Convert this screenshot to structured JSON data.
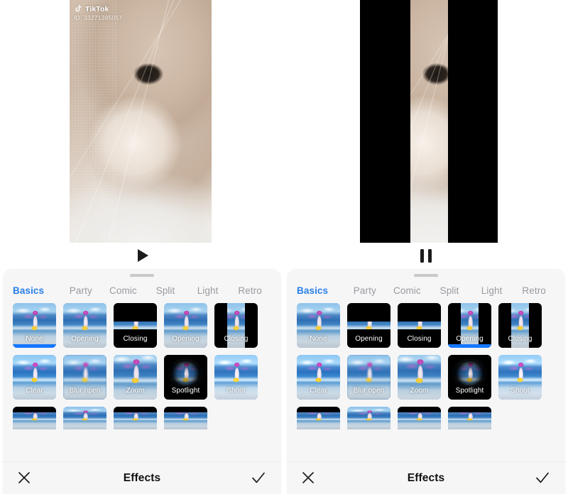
{
  "app": {
    "sheet_title": "Effects",
    "accent_color": "#1677ff",
    "tab_active_color": "#2a7fe8",
    "tab_inactive_color": "#9a9a9f"
  },
  "watermark": {
    "brand": "TikTok",
    "id": "ID: 33271385057",
    "icon": "tiktok-note-icon"
  },
  "panels": [
    {
      "key": "left",
      "transport": {
        "icon": "play-icon",
        "label": "Play",
        "state": "paused"
      },
      "preview": {
        "mode": "full",
        "description": "cat-profile-video-frame"
      },
      "tabs": [
        {
          "label": "Basics",
          "active": true
        },
        {
          "label": "Party",
          "active": false
        },
        {
          "label": "Comic",
          "active": false
        },
        {
          "label": "Split",
          "active": false
        },
        {
          "label": "Light",
          "active": false
        },
        {
          "label": "Retro",
          "active": false
        }
      ],
      "rows": [
        [
          {
            "label": "None",
            "style": "plain",
            "selected": true
          },
          {
            "label": "Opening",
            "style": "plain",
            "selected": false
          },
          {
            "label": "Closing",
            "style": "letterbox-h",
            "selected": false
          },
          {
            "label": "Opening",
            "style": "plain",
            "selected": false
          },
          {
            "label": "Closing",
            "style": "letterbox-v",
            "selected": false
          }
        ],
        [
          {
            "label": "Clear",
            "style": "clear",
            "selected": false
          },
          {
            "label": "Blur open",
            "style": "blur",
            "selected": false
          },
          {
            "label": "Zoom",
            "style": "zoom",
            "selected": false
          },
          {
            "label": "Spotlight",
            "style": "spotlight",
            "selected": false
          },
          {
            "label": "Shoot",
            "style": "shoot",
            "selected": false
          }
        ],
        [
          {
            "label": "",
            "style": "bar-top",
            "selected": false
          },
          {
            "label": "",
            "style": "plain",
            "selected": false
          },
          {
            "label": "",
            "style": "bar-top",
            "selected": false
          },
          {
            "label": "",
            "style": "bar-top",
            "selected": false
          }
        ]
      ],
      "footer": {
        "close_icon": "close-icon",
        "title": "Effects",
        "confirm_icon": "check-icon"
      }
    },
    {
      "key": "right",
      "transport": {
        "icon": "pause-icon",
        "label": "Pause",
        "state": "playing"
      },
      "preview": {
        "mode": "vertical-split",
        "description": "cat-profile-video-frame-with-black-bars"
      },
      "tabs": [
        {
          "label": "Basics",
          "active": true
        },
        {
          "label": "Party",
          "active": false
        },
        {
          "label": "Comic",
          "active": false
        },
        {
          "label": "Split",
          "active": false
        },
        {
          "label": "Light",
          "active": false
        },
        {
          "label": "Retro",
          "active": false
        }
      ],
      "rows": [
        [
          {
            "label": "None",
            "style": "plain",
            "selected": false
          },
          {
            "label": "Opening",
            "style": "letterbox-h",
            "selected": false
          },
          {
            "label": "Closing",
            "style": "letterbox-h",
            "selected": false
          },
          {
            "label": "Opening",
            "style": "letterbox-v",
            "selected": true
          },
          {
            "label": "Closing",
            "style": "letterbox-v",
            "selected": false
          }
        ],
        [
          {
            "label": "Clear",
            "style": "clear",
            "selected": false
          },
          {
            "label": "Blur open",
            "style": "blur",
            "selected": false
          },
          {
            "label": "Zoom",
            "style": "zoom",
            "selected": false
          },
          {
            "label": "Spotlight",
            "style": "spotlight",
            "selected": false
          },
          {
            "label": "Shoot",
            "style": "shoot",
            "selected": false
          }
        ],
        [
          {
            "label": "",
            "style": "bar-top",
            "selected": false
          },
          {
            "label": "",
            "style": "plain",
            "selected": false
          },
          {
            "label": "",
            "style": "bar-top",
            "selected": false
          },
          {
            "label": "",
            "style": "bar-top",
            "selected": false
          }
        ]
      ],
      "footer": {
        "close_icon": "close-icon",
        "title": "Effects",
        "confirm_icon": "check-icon"
      }
    }
  ]
}
